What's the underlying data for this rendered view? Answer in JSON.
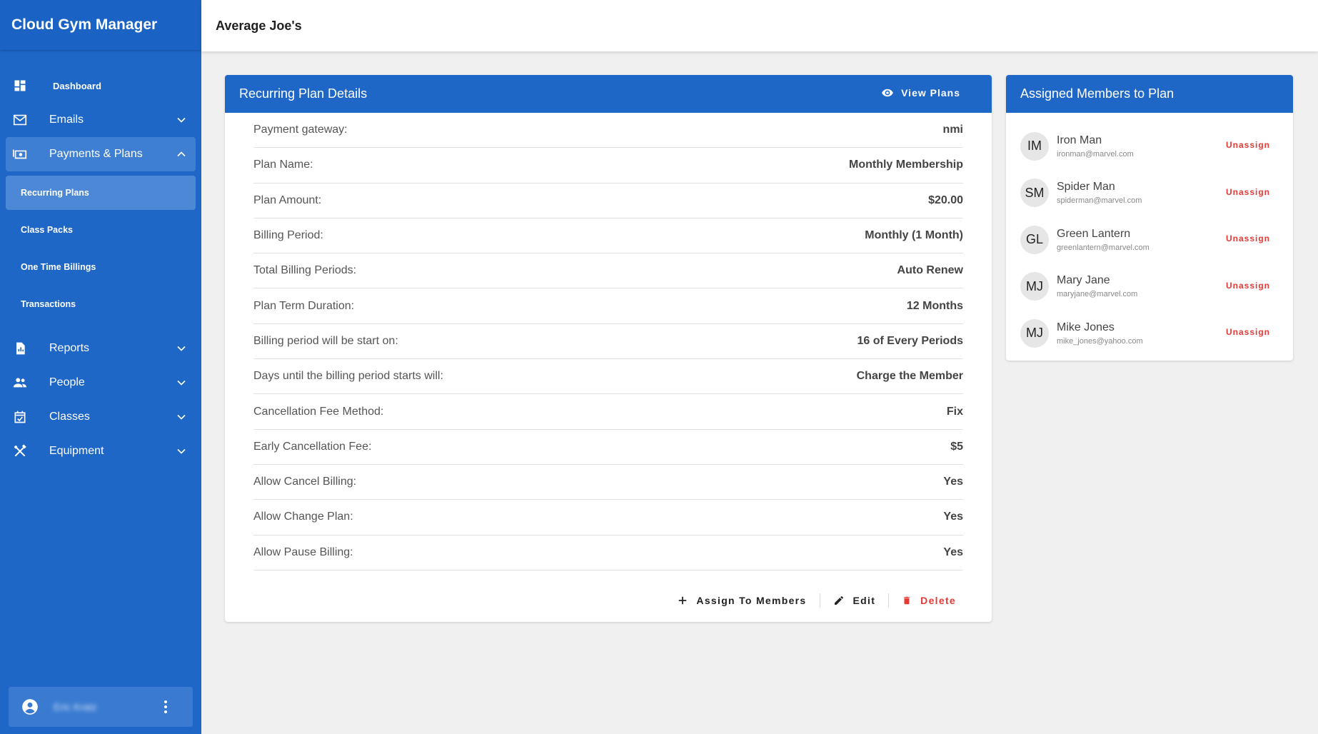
{
  "app": {
    "title": "Cloud Gym Manager"
  },
  "topbar": {
    "title": "Average Joe's"
  },
  "sidebar": {
    "items": [
      {
        "label": "Dashboard",
        "icon": "dashboard-icon"
      },
      {
        "label": "Emails",
        "icon": "mail-icon"
      },
      {
        "label": "Payments & Plans",
        "icon": "payments-icon",
        "expanded": true
      },
      {
        "label": "Reports",
        "icon": "report-icon"
      },
      {
        "label": "People",
        "icon": "people-icon"
      },
      {
        "label": "Classes",
        "icon": "calendar-icon"
      },
      {
        "label": "Equipment",
        "icon": "tools-icon"
      }
    ],
    "subitems": [
      {
        "label": "Recurring Plans",
        "active": true
      },
      {
        "label": "Class Packs"
      },
      {
        "label": "One Time Billings"
      },
      {
        "label": "Transactions"
      }
    ],
    "user": {
      "name": "Eric Kratz"
    }
  },
  "details": {
    "title": "Recurring Plan Details",
    "view_plans_label": "View Plans",
    "rows": [
      {
        "label": "Payment gateway:",
        "value": "nmi"
      },
      {
        "label": "Plan Name:",
        "value": "Monthly Membership"
      },
      {
        "label": "Plan Amount:",
        "value": "$20.00"
      },
      {
        "label": "Billing Period:",
        "value": "Monthly (1 Month)"
      },
      {
        "label": "Total Billing Periods:",
        "value": "Auto Renew"
      },
      {
        "label": "Plan Term Duration:",
        "value": "12 Months"
      },
      {
        "label": "Billing period will be start on:",
        "value": "16 of Every Periods"
      },
      {
        "label": "Days until the billing period starts will:",
        "value": "Charge the Member"
      },
      {
        "label": "Cancellation Fee Method:",
        "value": "Fix"
      },
      {
        "label": "Early Cancellation Fee:",
        "value": "$5"
      },
      {
        "label": "Allow Cancel Billing:",
        "value": "Yes"
      },
      {
        "label": "Allow Change Plan:",
        "value": "Yes"
      },
      {
        "label": "Allow Pause Billing:",
        "value": "Yes"
      }
    ],
    "actions": {
      "assign_label": "Assign To Members",
      "edit_label": "Edit",
      "delete_label": "Delete"
    }
  },
  "members": {
    "title": "Assigned Members to Plan",
    "unassign_label": "Unassign",
    "list": [
      {
        "initials": "IM",
        "name": "Iron Man",
        "email": "ironman@marvel.com"
      },
      {
        "initials": "SM",
        "name": "Spider Man",
        "email": "spiderman@marvel.com"
      },
      {
        "initials": "GL",
        "name": "Green Lantern",
        "email": "greenlantern@marvel.com"
      },
      {
        "initials": "MJ",
        "name": "Mary Jane",
        "email": "maryjane@marvel.com"
      },
      {
        "initials": "MJ",
        "name": "Mike Jones",
        "email": "mike_jones@yahoo.com"
      }
    ]
  },
  "colors": {
    "primary": "#1e67c7",
    "danger": "#e53935",
    "background": "#f0f0f0"
  }
}
